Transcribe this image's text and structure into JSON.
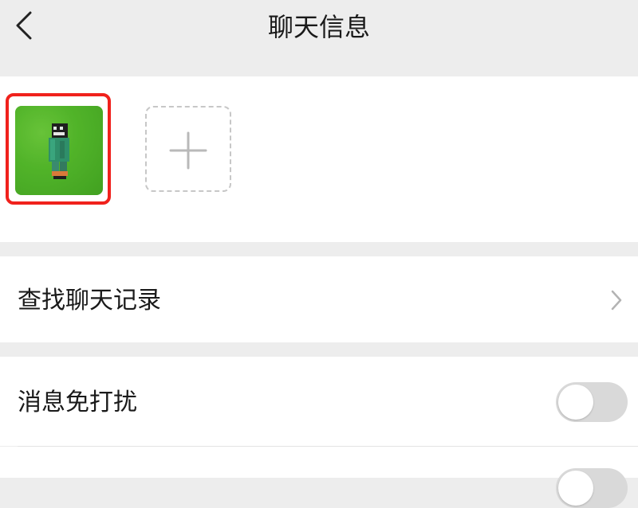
{
  "header": {
    "title": "聊天信息"
  },
  "members": {
    "add_icon": "plus-icon"
  },
  "settings": {
    "search_history_label": "查找聊天记录",
    "mute_label": "消息免打扰",
    "mute_enabled": false,
    "next_toggle_enabled": false
  },
  "colors": {
    "highlight": "#f0211c",
    "toggle_off": "#d9d9d9",
    "avatar_green": "#52b52a"
  }
}
